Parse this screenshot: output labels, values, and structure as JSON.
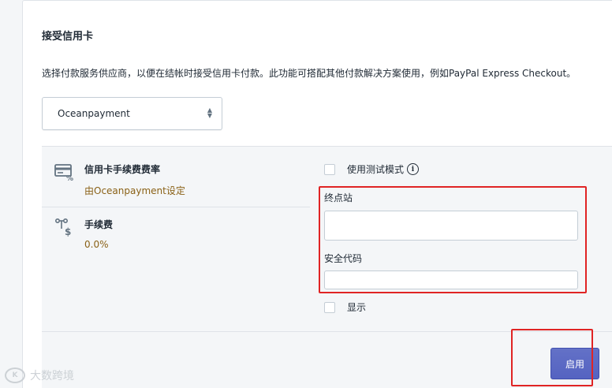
{
  "section": {
    "title": "接受信用卡",
    "description": "选择付款服务供应商，以便在结帐时接受信用卡付款。此功能可搭配其他付款解决方案使用，例如PayPal Express Checkout。"
  },
  "provider_select": {
    "selected": "Oceanpayment"
  },
  "fees": {
    "rate_title": "信用卡手续费费率",
    "rate_value": "由Oceanpayment设定",
    "fee_title": "手续费",
    "fee_value": "0.0%"
  },
  "settings": {
    "test_mode_label": "使用测试模式",
    "info_glyph": "i",
    "terminal_label": "终点站",
    "terminal_value": "",
    "security_code_label": "安全代码",
    "security_code_value": "",
    "show_label": "显示"
  },
  "actions": {
    "enable_label": "启用"
  },
  "watermark": {
    "logo_text": "K",
    "text": "大数跨境"
  },
  "colors": {
    "primary_button": "#5c6ac4",
    "highlight_border": "#e02424",
    "fee_value_text": "#8a6116"
  },
  "icons": {
    "rate_icon": "credit-card-percent-icon",
    "fee_icon": "transaction-fee-icon",
    "select_icon": "select-chevron-icon",
    "info_icon": "info-circle-icon"
  }
}
